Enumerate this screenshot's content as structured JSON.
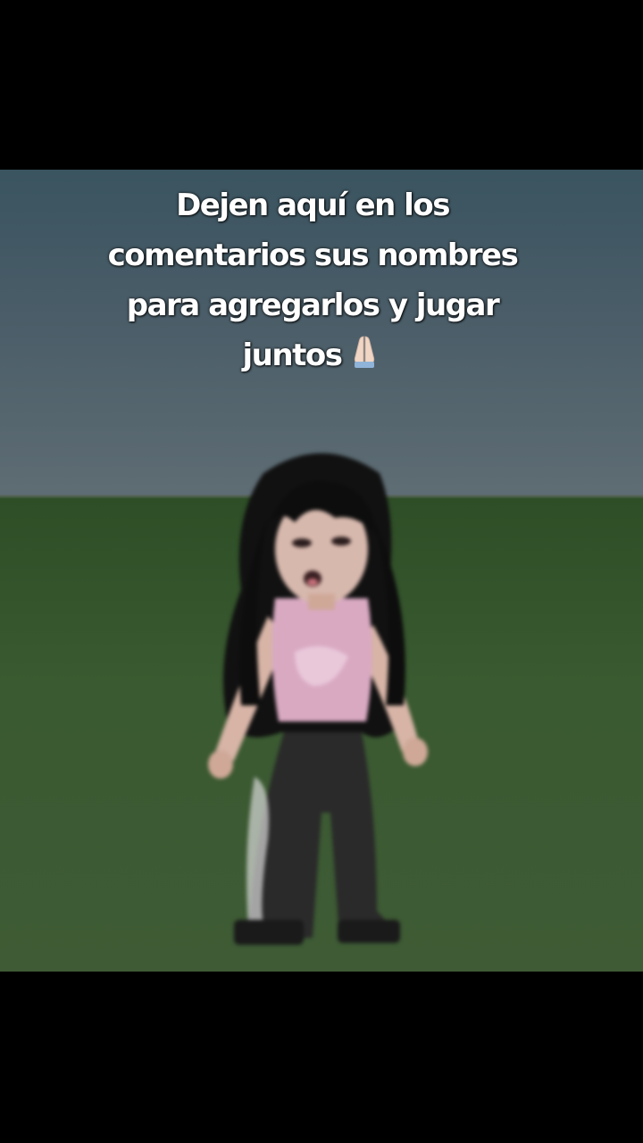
{
  "caption": {
    "line1": "Dejen aquí en los",
    "line2": "comentarios sus nombres",
    "line3": "para agregarlos y jugar",
    "line4": "juntos"
  },
  "icons": {
    "caption_emoji": "folded-hands-icon"
  },
  "colors": {
    "letterbox": "#000000",
    "sky": "#4a5d68",
    "ground": "#3a5a31",
    "caption_text": "#ffffff",
    "avatar_hair": "#111111",
    "avatar_top": "#d9a9c2",
    "avatar_pants": "#2a2a2a"
  }
}
